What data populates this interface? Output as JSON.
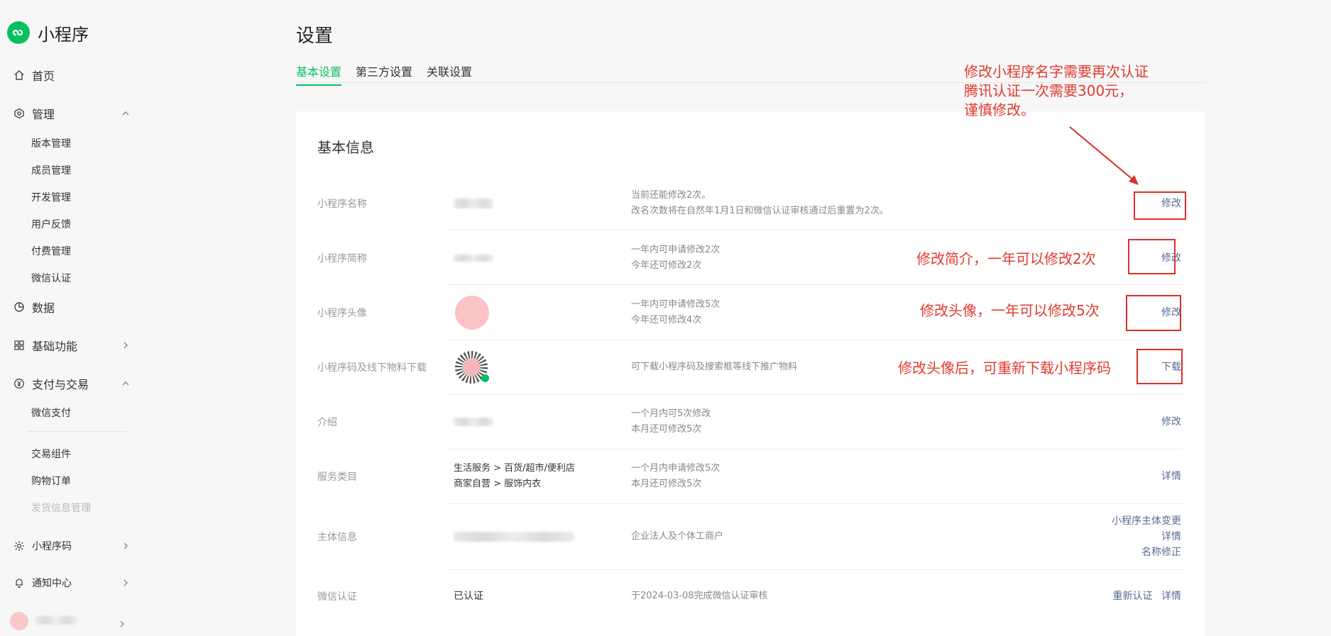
{
  "sidebar": {
    "brand": "小程序",
    "home": "首页",
    "manage": "管理",
    "manage_items": [
      "版本管理",
      "成员管理",
      "开发管理",
      "用户反馈",
      "付费管理",
      "微信认证"
    ],
    "data": "数据",
    "basic": "基础功能",
    "pay": "支付与交易",
    "pay_items": [
      "微信支付",
      "交易组件",
      "购物订单",
      "发货信息管理"
    ],
    "qrcode": "小程序码",
    "notice": "通知中心"
  },
  "header": {
    "title": "设置",
    "tabs": [
      "基本设置",
      "第三方设置",
      "关联设置"
    ]
  },
  "card": {
    "title": "基本信息",
    "rows": [
      {
        "label": "小程序名称",
        "desc1": "当前还能修改2次。",
        "desc2": "改名次数将在自然年1月1日和微信认证审核通过后重置为2次。",
        "action": "修改"
      },
      {
        "label": "小程序简称",
        "desc1": "一年内可申请修改2次",
        "desc2": "今年还可修改2次",
        "action": "修改"
      },
      {
        "label": "小程序头像",
        "desc1": "一年内可申请修改5次",
        "desc2": "今年还可修改4次",
        "action": "修改"
      },
      {
        "label": "小程序码及线下物料下载",
        "desc1": "可下载小程序码及搜索框等线下推广物料",
        "action": "下载"
      },
      {
        "label": "介绍",
        "desc1": "一个月内可5次修改",
        "desc2": "本月还可修改5次",
        "action": "修改"
      },
      {
        "label": "服务类目",
        "value1": "生活服务 > 百货/超市/便利店",
        "value2": "商家自营 > 服饰内衣",
        "desc1": "一个月内申请修改5次",
        "desc2": "本月还可修改5次",
        "action": "详情"
      },
      {
        "label": "主体信息",
        "desc1": "企业法人及个体工商户",
        "action1": "小程序主体变更",
        "action2": "详情",
        "action3": "名称修正"
      },
      {
        "label": "微信认证",
        "value1": "已认证",
        "desc1": "于2024-03-08完成微信认证审核",
        "action1": "重新认证",
        "action2": "详情"
      }
    ]
  },
  "annotations": {
    "name": [
      "修改小程序名字需要再次认证",
      "腾讯认证一次需要300元，",
      "谨慎修改。"
    ],
    "short": "修改简介，一年可以修改2次",
    "avatar": "修改头像，一年可以修改5次",
    "qrcode": "修改头像后，可重新下载小程序码",
    "color": "#e03a2f"
  }
}
